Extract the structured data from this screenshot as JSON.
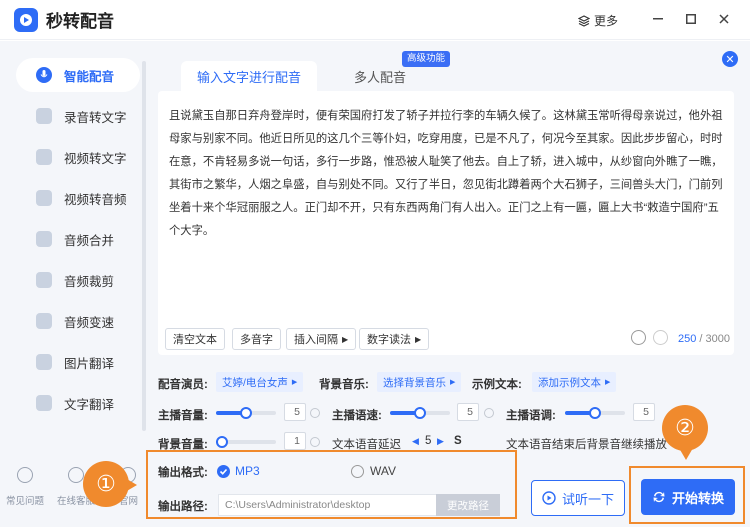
{
  "app": {
    "title": "秒转配音",
    "more_label": "更多"
  },
  "sidebar": {
    "items": [
      {
        "label": "智能配音",
        "icon": "mic-icon"
      },
      {
        "label": "录音转文字",
        "icon": "record-to-text-icon"
      },
      {
        "label": "视频转文字",
        "icon": "video-to-text-icon"
      },
      {
        "label": "视频转音频",
        "icon": "video-to-audio-icon"
      },
      {
        "label": "音频合并",
        "icon": "audio-merge-icon"
      },
      {
        "label": "音频裁剪",
        "icon": "audio-cut-icon"
      },
      {
        "label": "音频变速",
        "icon": "audio-speed-icon"
      },
      {
        "label": "图片翻译",
        "icon": "image-translate-icon"
      },
      {
        "label": "文字翻译",
        "icon": "text-translate-icon"
      }
    ],
    "bottom": [
      {
        "label": "常见问题",
        "icon": "help-icon"
      },
      {
        "label": "在线客服",
        "icon": "chat-icon"
      },
      {
        "label": "官网",
        "icon": "globe-icon"
      }
    ]
  },
  "tabs": {
    "active": "输入文字进行配音",
    "inactive": "多人配音",
    "badge": "高级功能"
  },
  "editor": {
    "text": "且说黛玉自那日弃舟登岸时，便有荣国府打发了轿子并拉行李的车辆久候了。这林黛玉常听得母亲说过，他外祖母家与别家不同。他近日所见的这几个三等仆妇，吃穿用度，已是不凡了，何况今至其家。因此步步留心，时时在意，不肯轻易多说一句话，多行一步路，惟恐被人耻笑了他去。自上了轿，进入城中，从纱窗向外瞧了一瞧，其街市之繁华，人烟之阜盛，自与别处不同。又行了半日，忽见街北蹲着两个大石狮子，三间兽头大门，门前列坐着十来个华冠丽服之人。正门却不开，只有东西两角门有人出入。正门之上有一匾，匾上大书“敕造宁国府”五个大字。",
    "tools": [
      "清空文本",
      "多音字",
      "插入间隔",
      "数字读法"
    ],
    "count_current": "250",
    "count_total": " / 3000"
  },
  "settings": {
    "voice_label": "配音演员:",
    "voice_value": "艾婷/电台女声",
    "bgm_label": "背景音乐:",
    "bgm_value": "选择背景音乐",
    "sample_label": "示例文本:",
    "sample_value": "添加示例文本",
    "volume_label": "主播音量:",
    "volume_value": "5",
    "volume_level": 0.5,
    "speed_label": "主播语速:",
    "speed_value": "5",
    "speed_level": 0.5,
    "pitch_label": "主播语调:",
    "pitch_value": "5",
    "pitch_level": 0.5,
    "bg_volume_label": "背景音量:",
    "bg_volume_value": "1",
    "bg_volume_level": 0.1,
    "delay_label": "文本语音延迟",
    "delay_value": "5",
    "delay_unit": "S",
    "continue_label": "文本语音结束后背景音继续播放"
  },
  "output": {
    "format_label": "输出格式:",
    "format_mp3": "MP3",
    "format_wav": "WAV",
    "selected": "MP3",
    "path_label": "输出路径:",
    "path_value": "C:\\Users\\Administrator\\desktop",
    "path_button": "更改路径"
  },
  "actions": {
    "try_label": "试听一下",
    "start_label": "开始转换"
  },
  "markers": {
    "one": "①",
    "two": "②"
  },
  "colors": {
    "accent": "#2e6cf6",
    "highlight": "#f08a2d"
  }
}
